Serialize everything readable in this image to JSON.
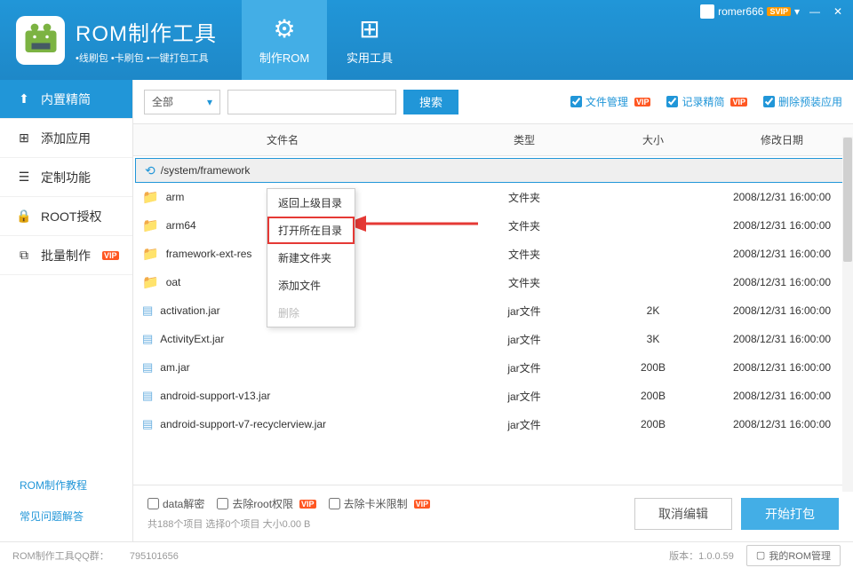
{
  "header": {
    "title": "ROM制作工具",
    "subtitle": "•线刷包 •卡刷包 •一键打包工具",
    "tabs": [
      {
        "label": "制作ROM",
        "icon": "gear",
        "active": true
      },
      {
        "label": "实用工具",
        "icon": "grid",
        "active": false
      }
    ],
    "user": {
      "name": "romer666",
      "badge": "SVIP"
    }
  },
  "sidebar": {
    "items": [
      {
        "icon": "upload",
        "label": "内置精简",
        "active": true
      },
      {
        "icon": "plus-box",
        "label": "添加应用"
      },
      {
        "icon": "edit-box",
        "label": "定制功能"
      },
      {
        "icon": "lock",
        "label": "ROOT授权"
      },
      {
        "icon": "batch",
        "label": "批量制作",
        "vip": "VIP"
      }
    ],
    "links": [
      {
        "label": "ROM制作教程"
      },
      {
        "label": "常见问题解答"
      }
    ]
  },
  "toolbar": {
    "dropdown": "全部",
    "search_btn": "搜索",
    "checks": [
      {
        "label": "文件管理",
        "vip": "VIP",
        "checked": true
      },
      {
        "label": "记录精简",
        "vip": "VIP",
        "checked": true
      },
      {
        "label": "删除预装应用",
        "checked": true
      }
    ]
  },
  "table": {
    "columns": {
      "name": "文件名",
      "type": "类型",
      "size": "大小",
      "date": "修改日期"
    },
    "path": "/system/framework",
    "rows": [
      {
        "name": "arm",
        "type": "文件夹",
        "size": "",
        "date": "2008/12/31 16:00:00",
        "kind": "folder"
      },
      {
        "name": "arm64",
        "type": "文件夹",
        "size": "",
        "date": "2008/12/31 16:00:00",
        "kind": "folder"
      },
      {
        "name": "framework-ext-res",
        "type": "文件夹",
        "size": "",
        "date": "2008/12/31 16:00:00",
        "kind": "folder"
      },
      {
        "name": "oat",
        "type": "文件夹",
        "size": "",
        "date": "2008/12/31 16:00:00",
        "kind": "folder"
      },
      {
        "name": "activation.jar",
        "type": "jar文件",
        "size": "2K",
        "date": "2008/12/31 16:00:00",
        "kind": "file"
      },
      {
        "name": "ActivityExt.jar",
        "type": "jar文件",
        "size": "3K",
        "date": "2008/12/31 16:00:00",
        "kind": "file"
      },
      {
        "name": "am.jar",
        "type": "jar文件",
        "size": "200B",
        "date": "2008/12/31 16:00:00",
        "kind": "file"
      },
      {
        "name": "android-support-v13.jar",
        "type": "jar文件",
        "size": "200B",
        "date": "2008/12/31 16:00:00",
        "kind": "file"
      },
      {
        "name": "android-support-v7-recyclerview.jar",
        "type": "jar文件",
        "size": "200B",
        "date": "2008/12/31 16:00:00",
        "kind": "file"
      }
    ]
  },
  "context_menu": {
    "items": [
      {
        "label": "返回上级目录"
      },
      {
        "label": "打开所在目录",
        "highlighted": true
      },
      {
        "label": "新建文件夹"
      },
      {
        "label": "添加文件"
      },
      {
        "label": "删除",
        "disabled": true
      }
    ]
  },
  "bottom": {
    "checks": [
      {
        "label": "data解密"
      },
      {
        "label": "去除root权限",
        "vip": "VIP"
      },
      {
        "label": "去除卡米限制",
        "vip": "VIP"
      }
    ],
    "stats": "共188个项目   选择0个项目   大小0.00 B",
    "cancel": "取消编辑",
    "start": "开始打包"
  },
  "status": {
    "qq_label": "ROM制作工具QQ群：",
    "qq_value": "795101656",
    "version": "版本：1.0.0.59",
    "rom_manage": "我的ROM管理"
  }
}
